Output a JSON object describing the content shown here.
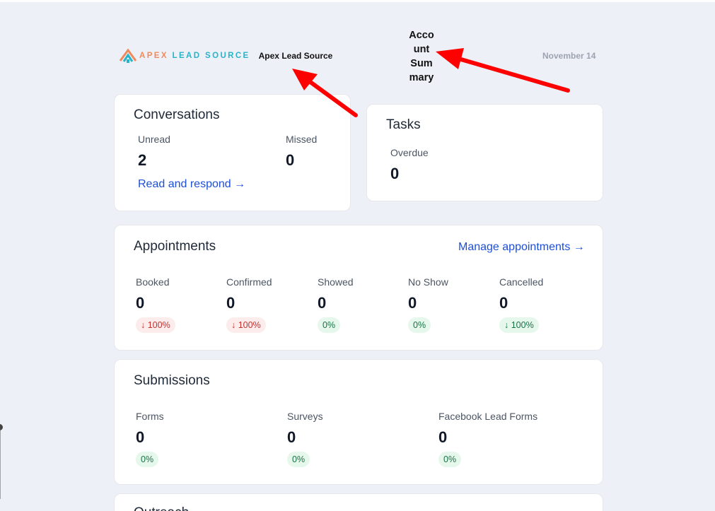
{
  "brand": {
    "logo_word_1": "APEX",
    "logo_word_2": "LEAD SOURCE",
    "name": "Apex Lead Source"
  },
  "header": {
    "title": "Account Summary",
    "title_lines": [
      "Acco",
      "unt",
      "Sum",
      "mary"
    ],
    "date": "November 14"
  },
  "conversations": {
    "title": "Conversations",
    "unread_label": "Unread",
    "unread_value": "2",
    "missed_label": "Missed",
    "missed_value": "0",
    "link": "Read and respond →"
  },
  "tasks": {
    "title": "Tasks",
    "overdue_label": "Overdue",
    "overdue_value": "0"
  },
  "appointments": {
    "title": "Appointments",
    "link": "Manage appointments →",
    "stats": [
      {
        "label": "Booked",
        "value": "0",
        "change": "↓ 100%",
        "trend": "down"
      },
      {
        "label": "Confirmed",
        "value": "0",
        "change": "↓ 100%",
        "trend": "down"
      },
      {
        "label": "Showed",
        "value": "0",
        "change": "0%",
        "trend": "neutral"
      },
      {
        "label": "No Show",
        "value": "0",
        "change": "0%",
        "trend": "neutral"
      },
      {
        "label": "Cancelled",
        "value": "0",
        "change": "↓ 100%",
        "trend": "good"
      }
    ]
  },
  "submissions": {
    "title": "Submissions",
    "stats": [
      {
        "label": "Forms",
        "value": "0",
        "change": "0%"
      },
      {
        "label": "Surveys",
        "value": "0",
        "change": "0%"
      },
      {
        "label": "Facebook Lead Forms",
        "value": "0",
        "change": "0%"
      }
    ]
  },
  "next_card": {
    "title": "Outreach"
  },
  "colors": {
    "background": "#eef0f8",
    "link": "#1d4ed8",
    "annotation_arrow": "#ff0000",
    "negative": "#c53030",
    "positive": "#177245"
  }
}
